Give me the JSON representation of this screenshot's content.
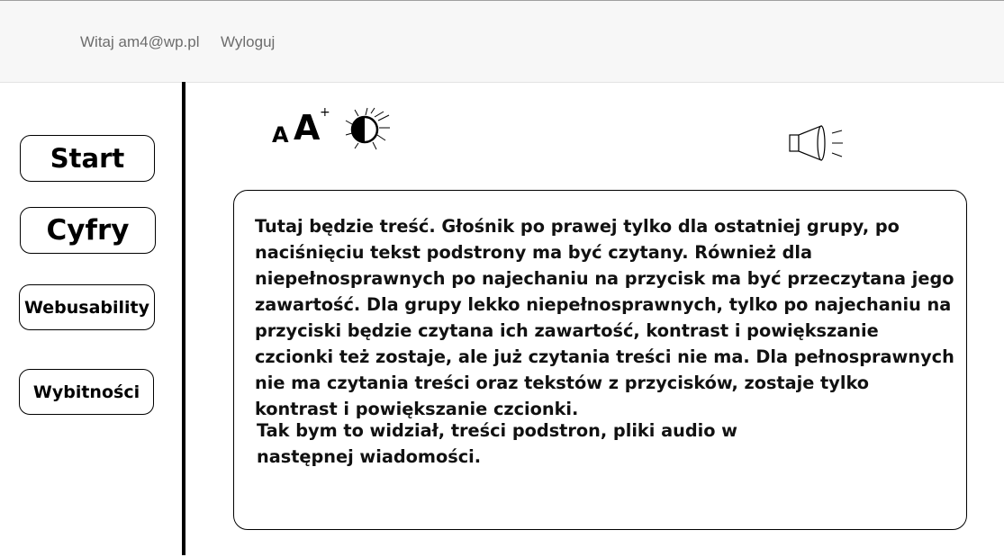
{
  "header": {
    "greeting": "Witaj am4@wp.pl",
    "logout_label": "Wyloguj"
  },
  "sidebar": {
    "items": [
      {
        "label": "Start"
      },
      {
        "label": "Cyfry"
      },
      {
        "label": "Webusability"
      },
      {
        "label": "Wybitności"
      }
    ]
  },
  "toolbar": {
    "font_small_label": "A",
    "font_large_label": "A",
    "font_plus_label": "+",
    "contrast_icon": "contrast-sun-icon",
    "speaker_icon": "speaker-icon"
  },
  "content": {
    "paragraphs": [
      "Tutaj będzie treść. Głośnik po prawej tylko dla ostatniej grupy, po naciśnięciu tekst podstrony ma być czytany. Również dla niepełnosprawnych po najechaniu na przycisk ma być przeczytana jego zawartość. Dla grupy lekko niepełnosprawnych, tylko po najechaniu na przyciski będzie czytana ich zawartość, kontrast i powiększanie czcionki też zostaje, ale już czytania treści nie ma. Dla pełnosprawnych nie ma czytania treści oraz tekstów z przycisków, zostaje tylko kontrast i powiększanie czcionki.",
      "Tak bym to widział, treści podstron, pliki audio w następnej wiadomości."
    ]
  }
}
